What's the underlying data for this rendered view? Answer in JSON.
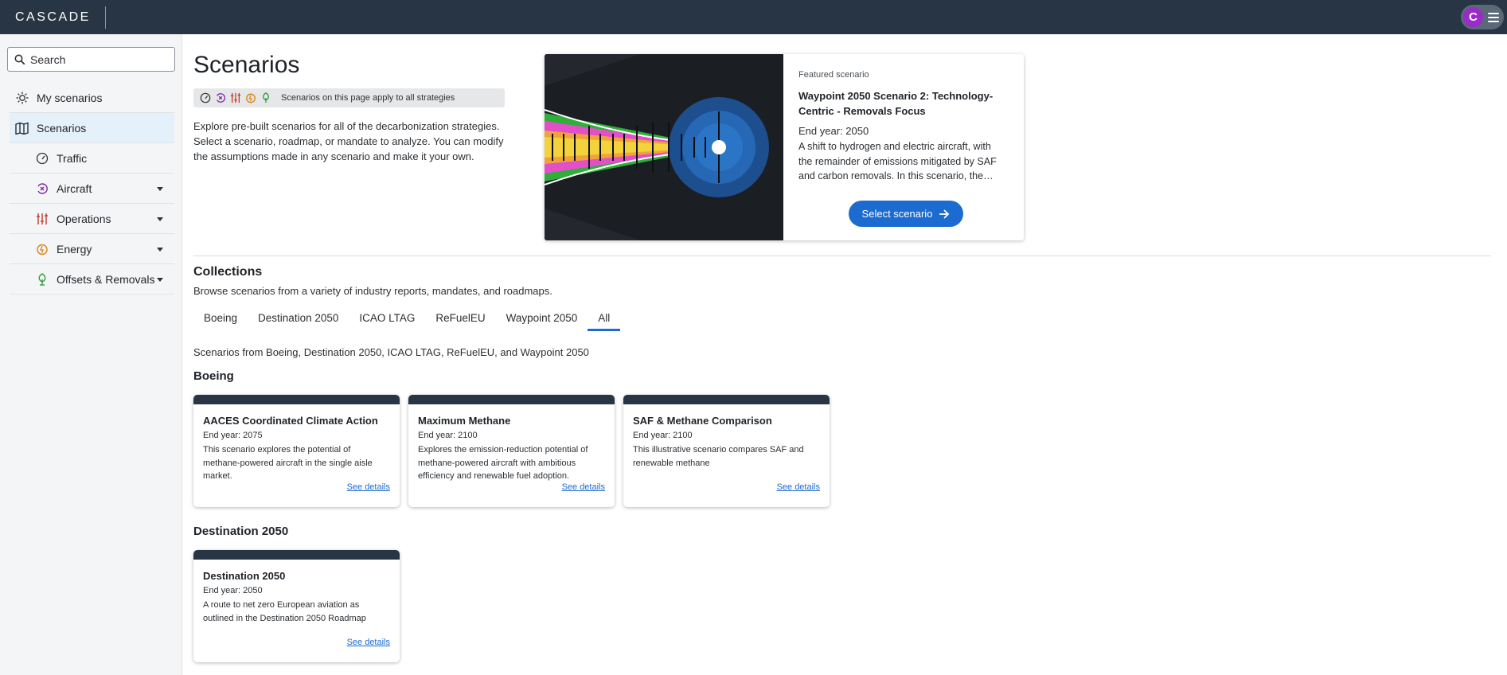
{
  "app": {
    "logo": "CASCADE",
    "user_initial": "C"
  },
  "sidebar": {
    "search_placeholder": "Search",
    "items": [
      {
        "label": "My scenarios",
        "icon": "sun-icon"
      },
      {
        "label": "Scenarios",
        "icon": "book-map-icon",
        "active": true
      },
      {
        "label": "Traffic",
        "icon": "gauge-icon"
      },
      {
        "label": "Aircraft",
        "icon": "aircraft-icon",
        "expandable": true
      },
      {
        "label": "Operations",
        "icon": "sliders-icon",
        "expandable": true
      },
      {
        "label": "Energy",
        "icon": "energy-icon",
        "expandable": true
      },
      {
        "label": "Offsets & Removals",
        "icon": "tree-icon",
        "expandable": true
      }
    ]
  },
  "page": {
    "title": "Scenarios",
    "applies_text": "Scenarios on this page apply to all strategies",
    "intro": "Explore pre-built scenarios for all of the decarbonization strategies. Select a scenario, roadmap, or mandate to analyze. You can modify the assumptions made in any scenario and make it your own."
  },
  "featured": {
    "kicker": "Featured scenario",
    "title": "Waypoint 2050 Scenario 2: Technology-Centric - Removals Focus",
    "end_year": "End year: 2050",
    "description": "A shift to hydrogen and electric aircraft, with the remainder of emissions mitigated by SAF and carbon removals. In this scenario, the…",
    "button": "Select scenario"
  },
  "collections": {
    "title": "Collections",
    "subtitle": "Browse scenarios from a variety of industry reports, mandates, and roadmaps.",
    "tabs": [
      "Boeing",
      "Destination 2050",
      "ICAO LTAG",
      "ReFuelEU",
      "Waypoint 2050",
      "All"
    ],
    "active_tab": "All",
    "scenarios_from": "Scenarios from Boeing, Destination 2050, ICAO LTAG, ReFuelEU, and Waypoint 2050"
  },
  "groups": [
    {
      "title": "Boeing",
      "cards": [
        {
          "title": "AACES Coordinated Climate Action",
          "end_year": "End year: 2075",
          "description": "This scenario explores the potential of methane-powered aircraft in the single aisle market.",
          "link": "See details"
        },
        {
          "title": "Maximum Methane",
          "end_year": "End year: 2100",
          "description": "Explores the emission-reduction potential of methane-powered aircraft with ambitious efficiency and renewable fuel adoption.",
          "link": "See details"
        },
        {
          "title": "SAF & Methane Comparison",
          "end_year": "End year: 2100",
          "description": "This illustrative scenario compares SAF and renewable methane",
          "link": "See details"
        }
      ]
    },
    {
      "title": "Destination 2050",
      "cards": [
        {
          "title": "Destination 2050",
          "end_year": "End year: 2050",
          "description": "A route to net zero European aviation as outlined in the Destination 2050 Roadmap",
          "link": "See details"
        }
      ]
    }
  ],
  "colors": {
    "topbar": "#283544",
    "accent": "#1b6bd1",
    "avatar": "#9a2ac9"
  }
}
